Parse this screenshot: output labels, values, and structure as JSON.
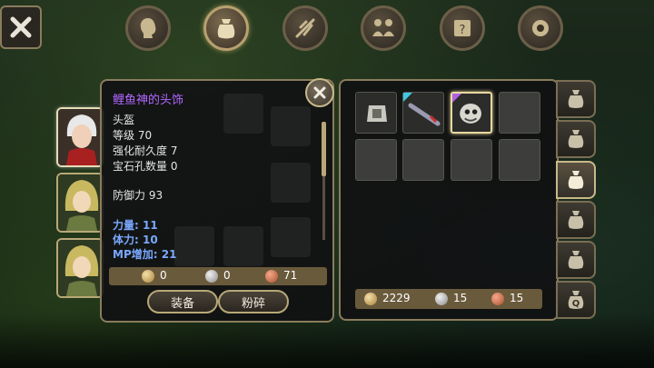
{
  "top_nav": {
    "tabs": [
      {
        "icon": "head-silhouette-icon",
        "active": false
      },
      {
        "icon": "bag-icon",
        "active": true
      },
      {
        "icon": "skill-feather-icon",
        "active": false
      },
      {
        "icon": "party-icon",
        "active": false
      },
      {
        "icon": "quest-scroll-icon",
        "active": false
      },
      {
        "icon": "settings-gear-icon",
        "active": false
      }
    ]
  },
  "item_info": {
    "name": "鲤鱼神的头饰",
    "type": "头盔",
    "level": "等级 70",
    "durability": "强化耐久度 7",
    "gem_slots": "宝石孔数量 0",
    "defense": "防御力 93",
    "stats": [
      "力量: 11",
      "体力: 10",
      "MP增加: 21"
    ],
    "price": {
      "gold": "0",
      "silver": "0",
      "copper": "71"
    },
    "equip_label": "装备",
    "smash_label": "粉碎"
  },
  "inventory": {
    "money": {
      "gold": "2229",
      "silver": "15",
      "copper": "15"
    },
    "selected_slot": 2
  },
  "colors": {
    "item_name": "#b066ff",
    "stat_blue": "#7aa8ff",
    "panel_border": "#8a7c5c",
    "rare_corner": "#40c8e0",
    "epic_corner": "#b060e0"
  }
}
